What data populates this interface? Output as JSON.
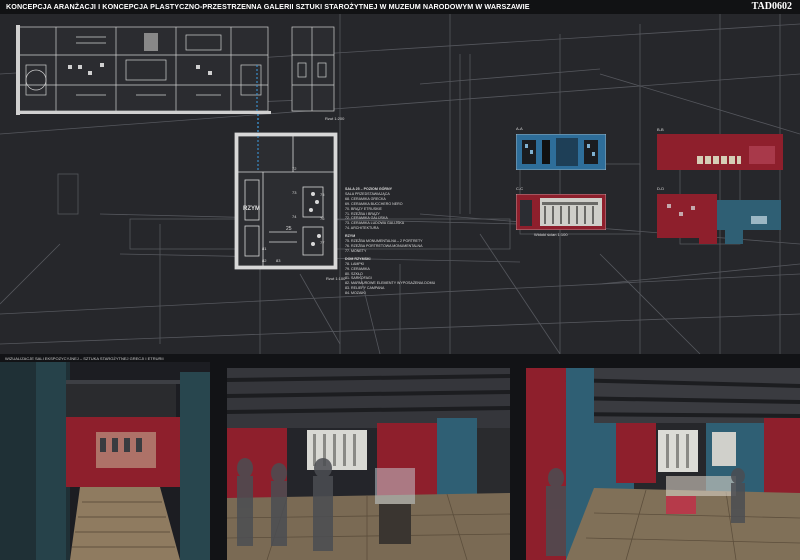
{
  "header": {
    "title": "KONCEPCJA ARANŻACJI I KONCEPCJA PLASTYCZNO-PRZESTRZENNA GALERII SZTUKI STAROŻYTNEJ W MUZEUM NARODOWYM W WARSZAWIE",
    "code": "TAD0602"
  },
  "plans": {
    "scale_top": "Rzut 1:200",
    "scale_mid": "Rzut 1:100",
    "room_label": "RZYM",
    "room_numbers": [
      "72",
      "73",
      "74",
      "75",
      "76",
      "77",
      "81",
      "82",
      "83",
      "25"
    ]
  },
  "legend": [
    {
      "text": "SALA 25 – POZIOM GÓRNY",
      "heading": true
    },
    {
      "text": "SALA PRZEDSTAWIAJĄCA",
      "heading": false
    },
    {
      "text": "68.  CERAMIKA GRECKA",
      "heading": false
    },
    {
      "text": "69.  CERAMIKA BUCCHERO NERO",
      "heading": false
    },
    {
      "text": "70.  BRĄZY ETRUSKIE",
      "heading": false
    },
    {
      "text": "71.  RZEŹBA I BRĄZY",
      "heading": false
    },
    {
      "text": "72.  CERAMIKA GALIJSKA",
      "heading": false
    },
    {
      "text": "73.  CERAMIKA LUDOWA GALIJSKA",
      "heading": false
    },
    {
      "text": "74.  ARCHITEKTURA",
      "heading": false
    },
    {
      "text": "RZYM",
      "heading": true
    },
    {
      "text": "75.  RZEŹBA MONUMENTALNA – 2 PORTRETY",
      "heading": false
    },
    {
      "text": "76.  RZEŹBA PORTRETOWA MONUMENTALNA",
      "heading": false
    },
    {
      "text": "77.  MONETY",
      "heading": false
    },
    {
      "text": "DOM RZYMSKI",
      "heading": true
    },
    {
      "text": "78.  LAMPKI",
      "heading": false
    },
    {
      "text": "79.  CERAMIKA",
      "heading": false
    },
    {
      "text": "80.  SZKŁO",
      "heading": false
    },
    {
      "text": "81.  SARKOFAGI",
      "heading": false
    },
    {
      "text": "82.  MARMUROWE ELEMENTY WYPOSAŻENIA DOMU",
      "heading": false
    },
    {
      "text": "83.  RELIEFY CAMPANA",
      "heading": false
    },
    {
      "text": "84.  MOZAIKI",
      "heading": false
    }
  ],
  "sections": {
    "aa": "A-A",
    "bb": "B-B",
    "cc": "C-C",
    "dd": "D-D",
    "scale": "Widoki ścian 1:100"
  },
  "visualizations": {
    "caption": "WIZUALIZACJE SALI EKSPOZYCYJNEJ – SZTUKA STAROŻYTNEJ GRECJI I ETRURII"
  },
  "colors": {
    "background": "#26272b",
    "wall_red": "#8e1f2c",
    "wall_teal": "#2f5f74",
    "plan_lines": "#cfcfcf",
    "accent_blue": "#3a8dc8"
  }
}
